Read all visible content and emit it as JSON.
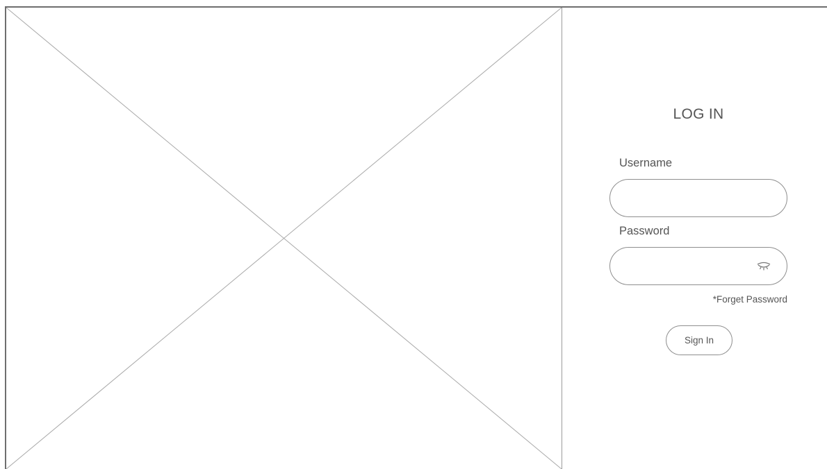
{
  "login": {
    "title": "LOG IN",
    "username_label": "Username",
    "username_value": "",
    "password_label": "Password",
    "password_value": "",
    "forgot_password": "*Forget Password",
    "sign_in_label": "Sign In"
  },
  "icons": {
    "password_toggle": "eye-closed-icon",
    "image_placeholder": "image-placeholder-cross"
  },
  "colors": {
    "border": "#8e8e8e",
    "text": "#555555",
    "frame": "#6e6e6e"
  }
}
